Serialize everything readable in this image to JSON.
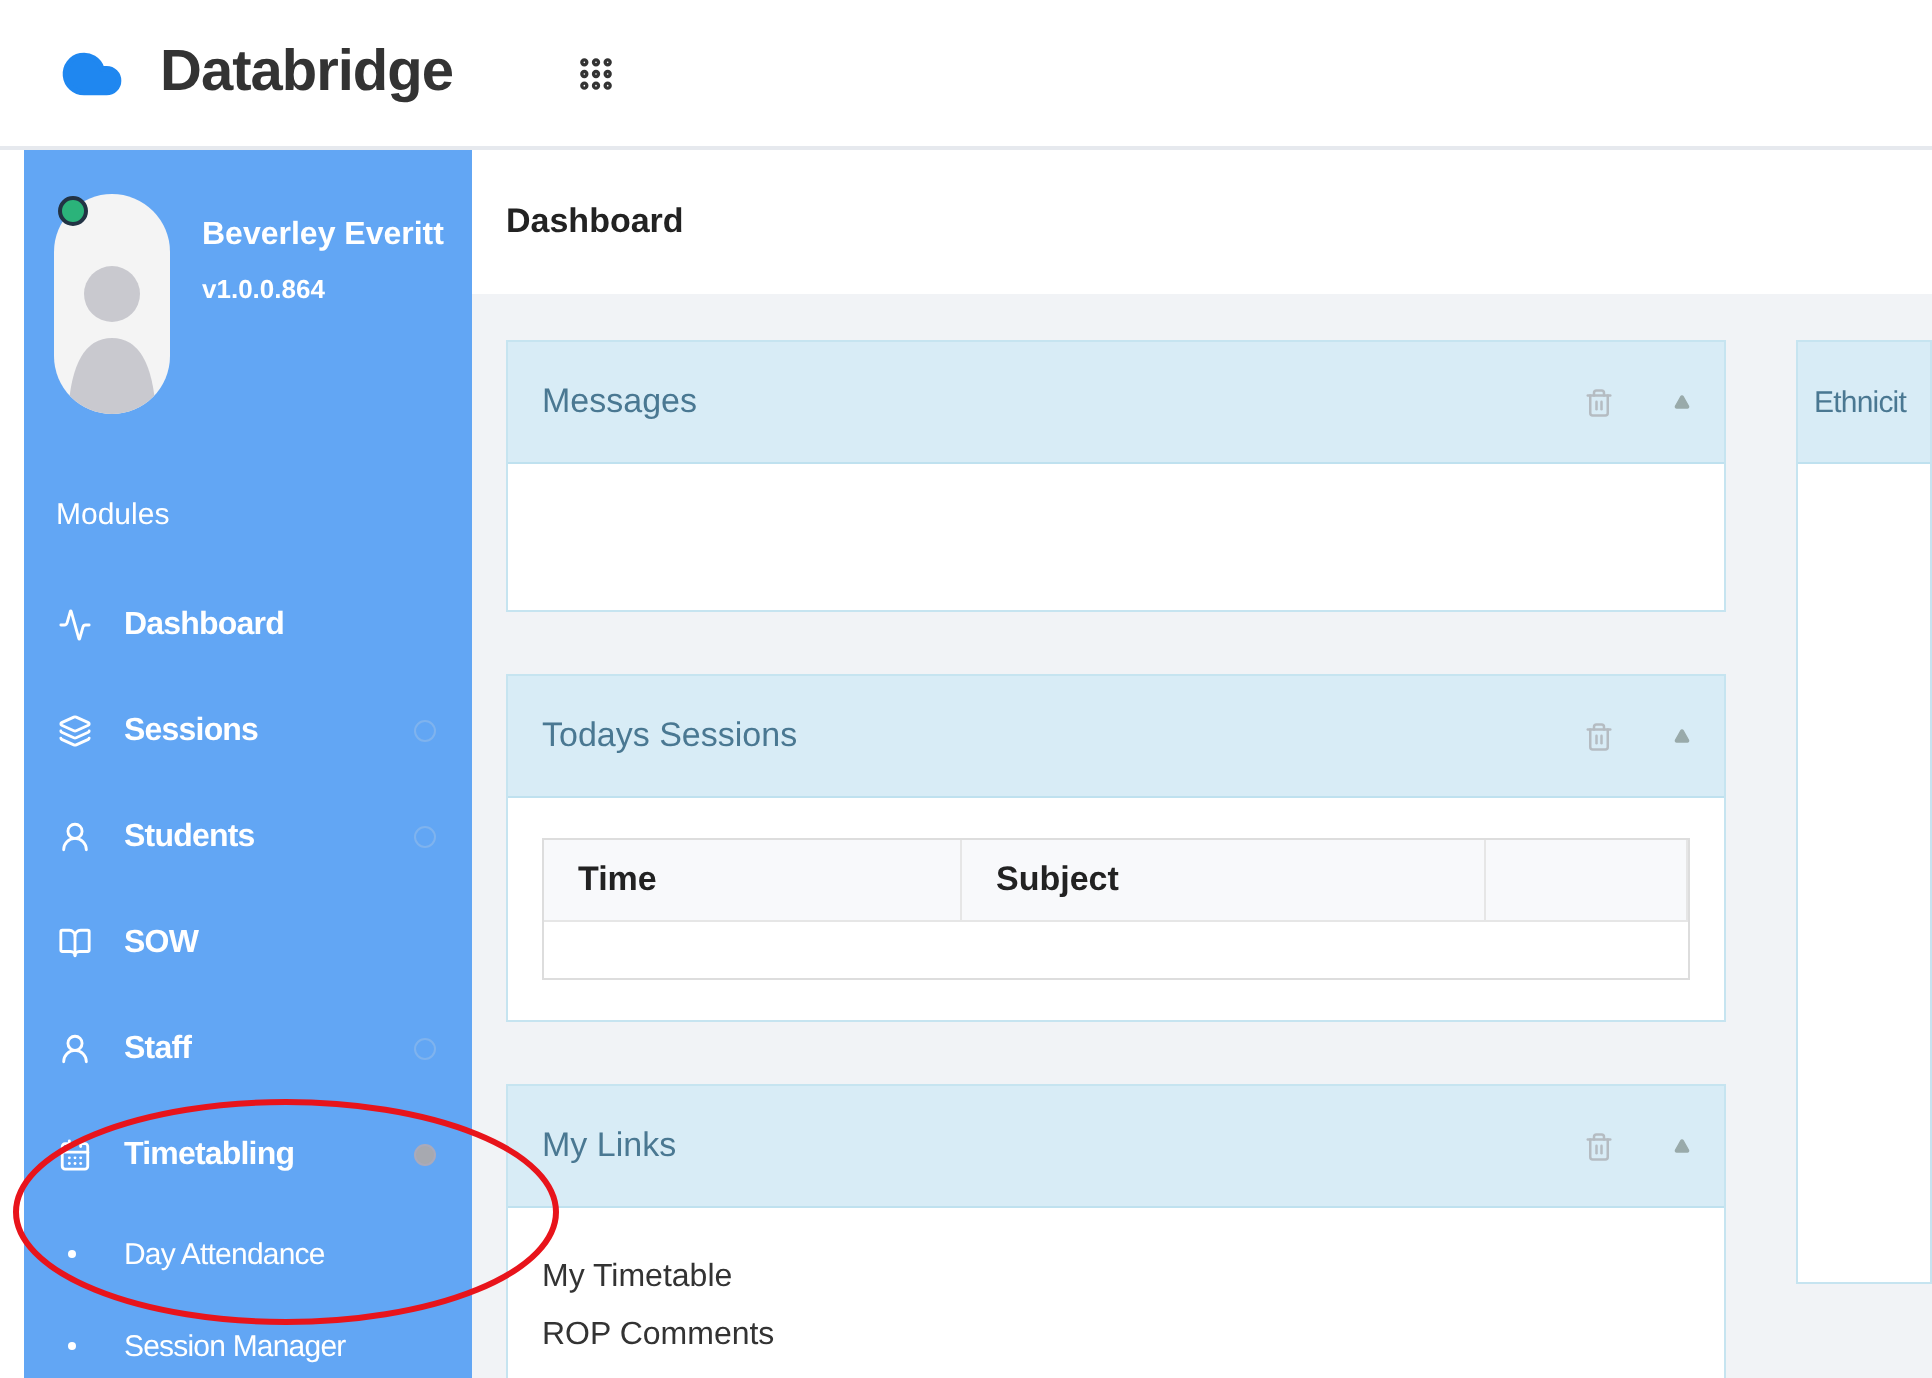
{
  "app": {
    "title": "Databridge"
  },
  "user": {
    "name": "Beverley Everitt",
    "version": "v1.0.0.864",
    "online": true
  },
  "sidebar": {
    "heading": "Modules",
    "items": [
      {
        "label": "Dashboard"
      },
      {
        "label": "Sessions",
        "expanded": false
      },
      {
        "label": "Students",
        "expanded": false
      },
      {
        "label": "SOW"
      },
      {
        "label": "Staff",
        "expanded": false
      },
      {
        "label": "Timetabling",
        "expanded": true,
        "children": [
          {
            "label": "Day Attendance"
          },
          {
            "label": "Session Manager"
          }
        ]
      }
    ]
  },
  "breadcrumb": "Dashboard",
  "panels": [
    {
      "kind": "empty",
      "title": "Messages"
    },
    {
      "kind": "table",
      "title": "Todays Sessions",
      "columns": [
        "Time",
        "Subject"
      ]
    },
    {
      "kind": "links",
      "title": "My Links",
      "links": [
        "My Timetable",
        "ROP Comments"
      ]
    }
  ],
  "side_panel": {
    "title": "Ethnicit"
  }
}
